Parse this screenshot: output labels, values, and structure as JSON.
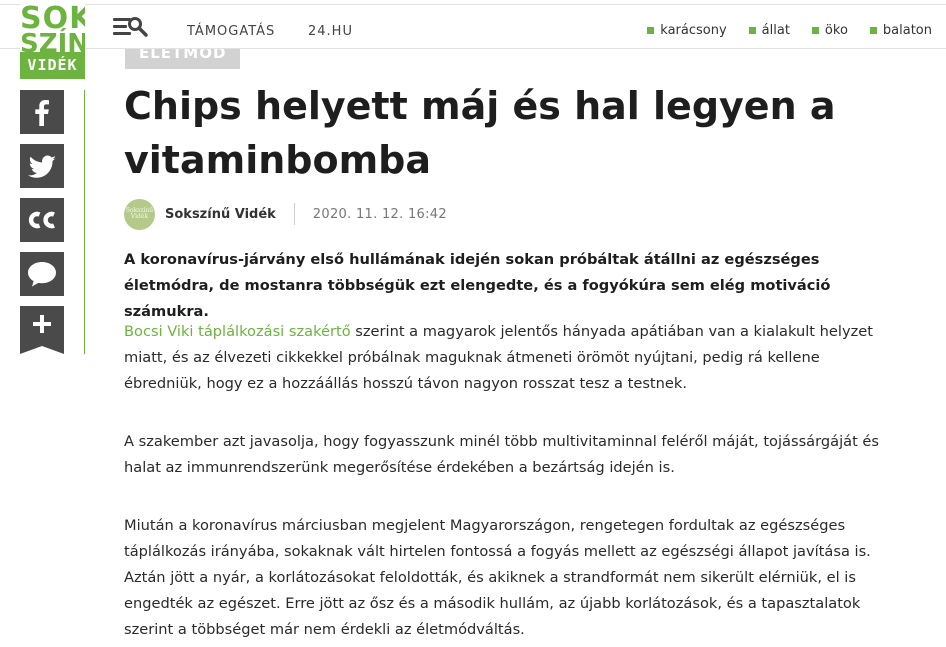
{
  "brand": {
    "line1": "SOK",
    "line2": "SZÍNŰ",
    "line3": "VIDÉK",
    "accent_color": "#6cb33f"
  },
  "header": {
    "menu_icon": "menu-search-icon",
    "nav": [
      "TÁMOGATÁS",
      "24.HU"
    ],
    "tags": [
      "karácsony",
      "állat",
      "öko",
      "balaton"
    ]
  },
  "share": {
    "icons": [
      "facebook-icon",
      "twitter-icon",
      "cc-icon",
      "comment-icon",
      "plus-icon"
    ]
  },
  "article": {
    "category": "ÉLETMÓD",
    "title": "Chips helyett máj és hal legyen a vitaminbomba",
    "avatar_text": "Sokszínű Vidék",
    "author": "Sokszínű Vidék",
    "date": "2020. 11. 12. 16:42",
    "lead": "A koronavírus-járvány első hullámának idején sokan próbáltak átállni az egészséges életmódra, de mostanra többségük ezt elengedte, és a fogyókúra sem elég motiváció számukra.",
    "p1_link": "Bocsi Viki táplálkozási szakértő",
    "p1_rest": " szerint a magyarok jelentős hányada apátiában van a kialakult helyzet miatt, és az élvezeti cikkekkel próbálnak maguknak átmeneti örömöt nyújtani, pedig rá kellene ébredniük, hogy ez a hozzáállás hosszú távon nagyon rosszat tesz a testnek.",
    "p2": "A szakember azt javasolja, hogy fogyasszunk minél több multivitaminnal feléről máját, tojássárgáját és halat az immunrendszerünk megerősítése érdekében a bezártság idején is.",
    "p3": "Miután a koronavírus márciusban megjelent Magyarországon, rengetegen fordultak az egészséges táplálkozás irányába, sokaknak vált hirtelen fontossá a fogyás mellett az egészségi állapot javítása is. Aztán jött a nyár, a korlátozásokat feloldották, és akiknek a strandformát nem sikerült elérniük, el is engedték az egészet. Erre jött az ősz és a második hullám, az újabb korlátozások, és a tapasztalatok szerint a többséget már nem érdekli az életmódváltás."
  }
}
